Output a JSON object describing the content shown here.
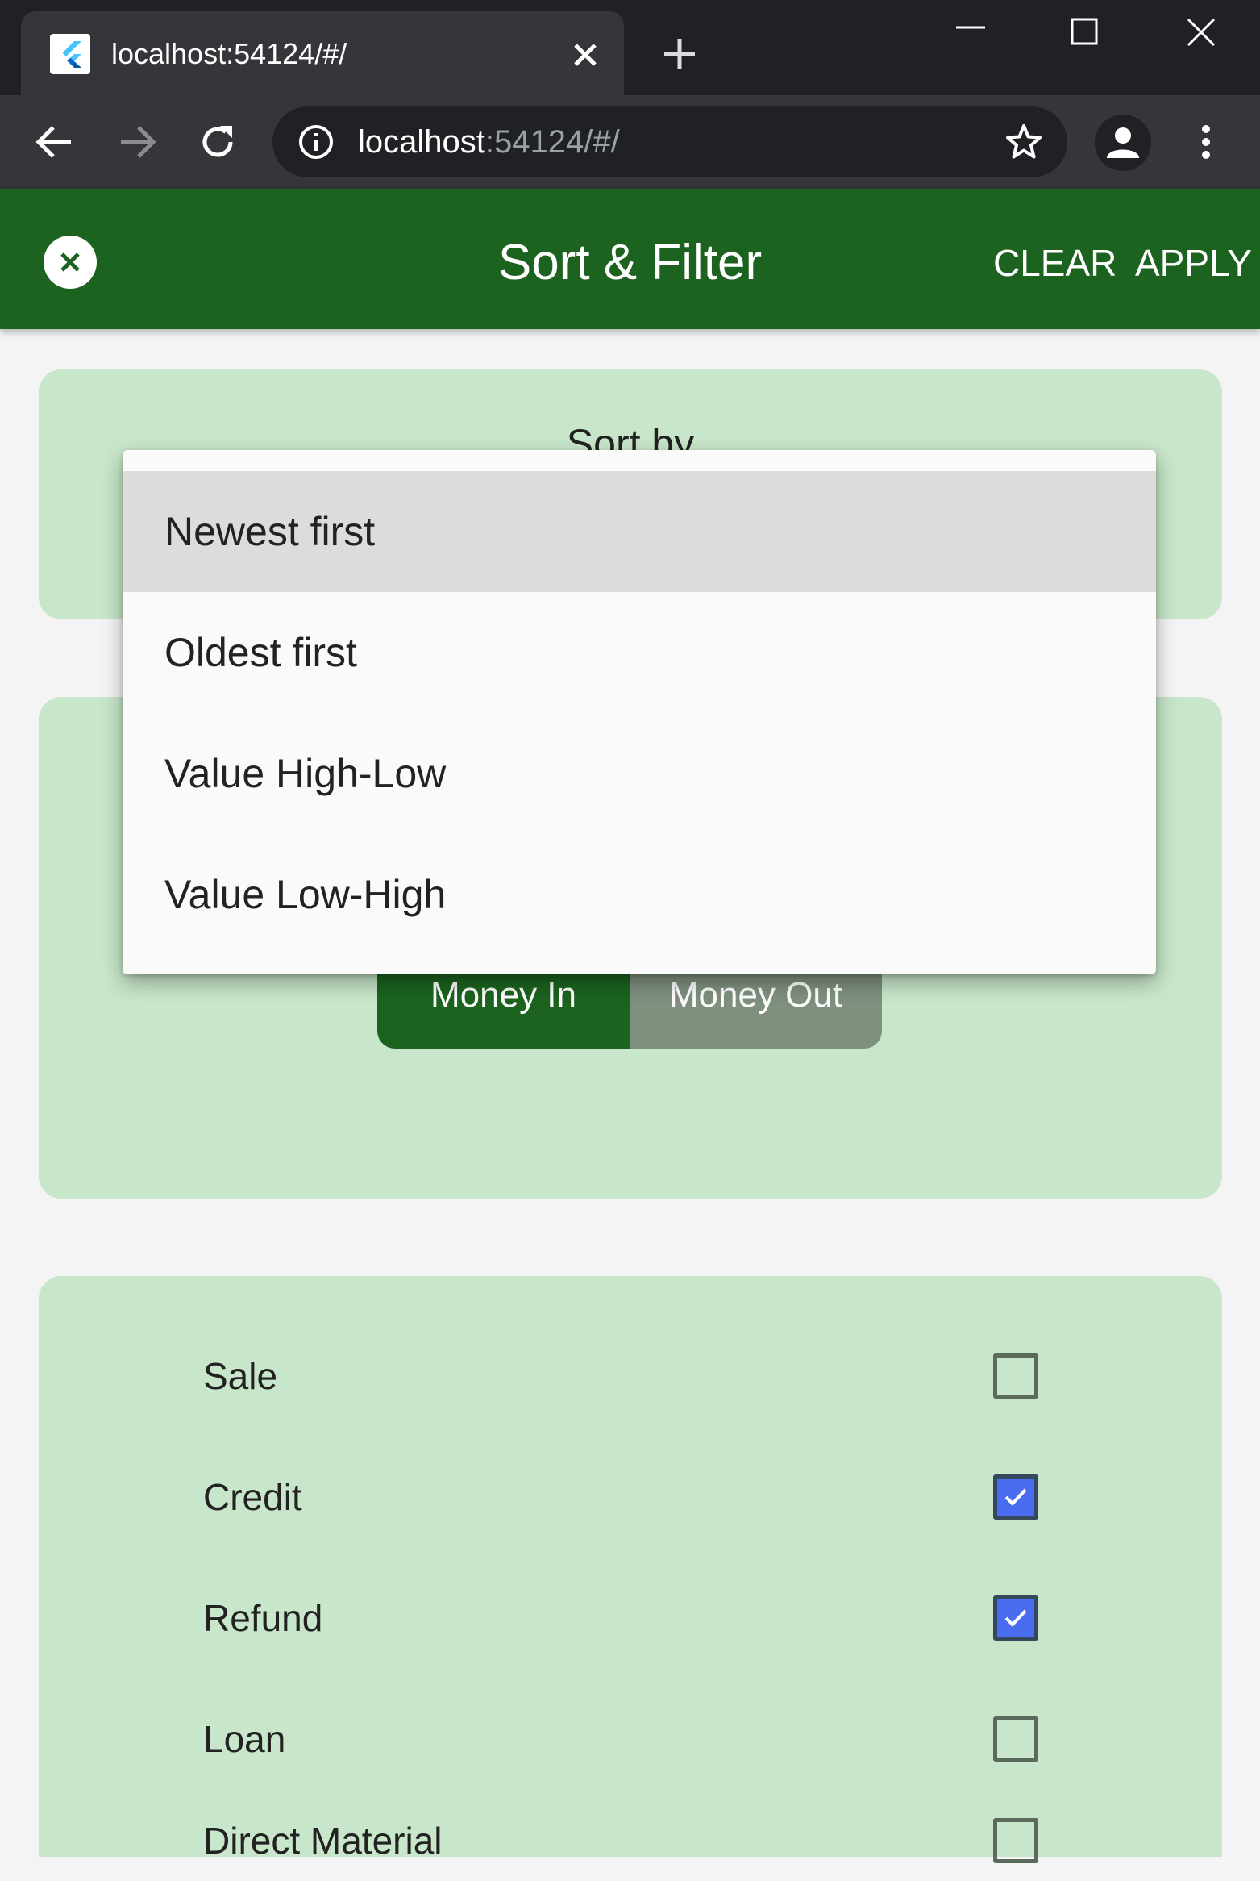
{
  "browser": {
    "tab_title": "localhost:54124/#/",
    "url_host": "localhost",
    "url_rest": ":54124/#/"
  },
  "appbar": {
    "title": "Sort & Filter",
    "clear_label": "CLEAR",
    "apply_label": "APPLY"
  },
  "sort": {
    "label": "Sort by",
    "options": [
      {
        "label": "Newest first",
        "selected": true
      },
      {
        "label": "Oldest first",
        "selected": false
      },
      {
        "label": "Value High-Low",
        "selected": false
      },
      {
        "label": "Value Low-High",
        "selected": false
      }
    ]
  },
  "type_toggle": {
    "money_in_label": "Money In",
    "money_out_label": "Money Out",
    "selected": "Money In"
  },
  "categories": [
    {
      "label": "Sale",
      "checked": false
    },
    {
      "label": "Credit",
      "checked": true
    },
    {
      "label": "Refund",
      "checked": true
    },
    {
      "label": "Loan",
      "checked": false
    },
    {
      "label": "Direct Material",
      "checked": false
    }
  ],
  "colors": {
    "appbar": "#1b631f",
    "card": "#c8e6c9",
    "checkbox_checked": "#4a6cf0",
    "toggle_unselected": "#7f907f"
  }
}
